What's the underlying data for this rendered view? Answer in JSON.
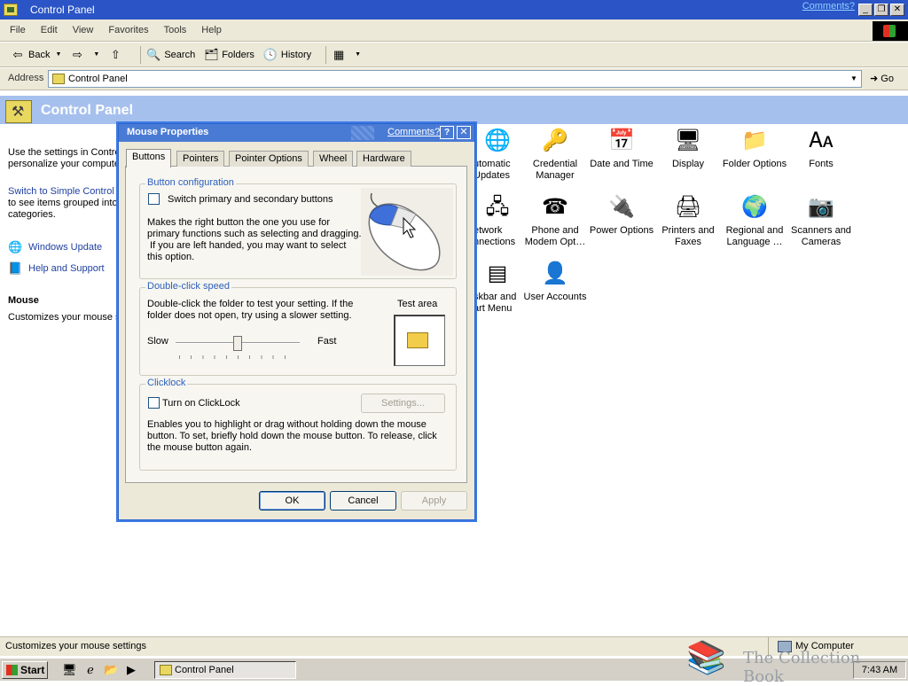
{
  "window": {
    "title": "Control Panel",
    "comments_link": "Comments?"
  },
  "menu": [
    "File",
    "Edit",
    "View",
    "Favorites",
    "Tools",
    "Help"
  ],
  "toolbar": {
    "back": "Back",
    "search": "Search",
    "folders": "Folders",
    "history": "History"
  },
  "address": {
    "label": "Address",
    "value": "Control Panel",
    "go": "Go"
  },
  "panel": {
    "title": "Control Panel"
  },
  "left_pane": {
    "intro": "Use the settings in Control Panel to personalize your computer.",
    "intro_line1": "Use the settings in Contro",
    "intro_line2": "personalize your compute",
    "switch_link": "Switch to Simple Control P",
    "switch_line2": "to see items grouped into",
    "switch_line3": "categories.",
    "links": [
      "Windows Update",
      "Help and Support"
    ],
    "selected_title": "Mouse",
    "selected_desc": "Customizes your mouse se"
  },
  "icons": [
    {
      "label": "utomatic\nUpdates",
      "glyph": "🌐"
    },
    {
      "label": "Credential\nManager",
      "glyph": "🔑"
    },
    {
      "label": "Date and Time",
      "glyph": "📅"
    },
    {
      "label": "Display",
      "glyph": "🖥"
    },
    {
      "label": "Folder Options",
      "glyph": "📁"
    },
    {
      "label": "Fonts",
      "glyph": "🗛"
    },
    {
      "label": "etwork\nnnections",
      "glyph": "🖧"
    },
    {
      "label": "Phone and\nModem Opt…",
      "glyph": "☎"
    },
    {
      "label": "Power Options",
      "glyph": "🔌"
    },
    {
      "label": "Printers and\nFaxes",
      "glyph": "🖨"
    },
    {
      "label": "Regional and\nLanguage …",
      "glyph": "🌍"
    },
    {
      "label": "Scanners and\nCameras",
      "glyph": "📷"
    },
    {
      "label": "skbar and\nart Menu",
      "glyph": "▤"
    },
    {
      "label": "User Accounts",
      "glyph": "👤"
    }
  ],
  "status": {
    "text": "Customizes your mouse settings",
    "zone": "My Computer"
  },
  "taskbar": {
    "start": "Start",
    "task": "Control Panel",
    "clock": "7:43 AM"
  },
  "watermark": "The Collection Book",
  "dialog": {
    "title": "Mouse Properties",
    "comments": "Comments?",
    "help": "?",
    "tabs": [
      "Buttons",
      "Pointers",
      "Pointer Options",
      "Wheel",
      "Hardware"
    ],
    "active_tab": "Buttons",
    "button_config": {
      "title": "Button configuration",
      "switch_label": "Switch primary and secondary buttons",
      "switch_checked": false,
      "desc_lines": [
        "Makes the right button the one you use for",
        "primary functions such as selecting and dragging.",
        " If you are left handed, you may want to select",
        "this option."
      ]
    },
    "double_click": {
      "title": "Double-click speed",
      "desc_lines": [
        "Double-click the folder to test your setting.  If the",
        "folder does not open, try using a slower setting."
      ],
      "test_area": "Test area",
      "slow": "Slow",
      "fast": "Fast",
      "speed_fraction": 0.5
    },
    "clicklock": {
      "title": "Clicklock",
      "label": "Turn on ClickLock",
      "checked": false,
      "settings_button": "Settings...",
      "desc_lines": [
        "Enables you to highlight or drag without holding down the mouse",
        "button.  To set, briefly hold down the mouse button.  To release, click",
        "the mouse button again."
      ]
    },
    "buttons": {
      "ok": "OK",
      "cancel": "Cancel",
      "apply": "Apply"
    }
  }
}
